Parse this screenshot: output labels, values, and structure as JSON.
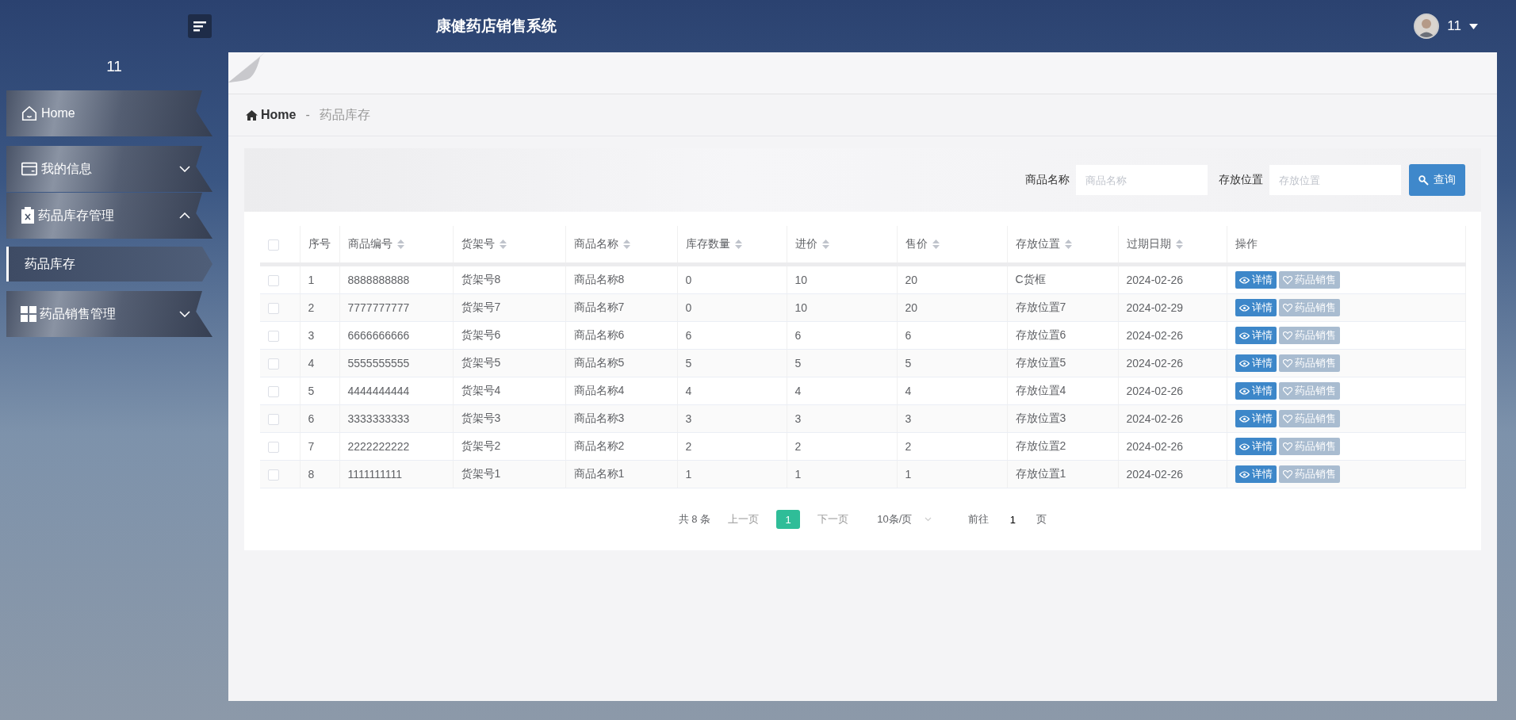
{
  "header": {
    "title": "康健药店销售系统",
    "user_name": "11"
  },
  "sidebar": {
    "user_name": "11",
    "items": [
      {
        "kind": "link",
        "label": "Home"
      },
      {
        "kind": "group",
        "label": "我的信息",
        "expanded": false
      },
      {
        "kind": "group",
        "label": "药品库存管理",
        "expanded": true,
        "children": [
          {
            "label": "药品库存",
            "selected": true
          }
        ]
      },
      {
        "kind": "group",
        "label": "药品销售管理",
        "expanded": false
      }
    ]
  },
  "breadcrumb": {
    "home": "Home",
    "separator": "-",
    "current": "药品库存"
  },
  "search": {
    "fields": [
      {
        "label": "商品名称",
        "placeholder": "商品名称"
      },
      {
        "label": "存放位置",
        "placeholder": "存放位置"
      }
    ],
    "button": "查询"
  },
  "table": {
    "select_all": {
      "checked": false
    },
    "columns": [
      {
        "label": "序号",
        "sortable": false
      },
      {
        "label": "商品编号",
        "sortable": true
      },
      {
        "label": "货架号",
        "sortable": true
      },
      {
        "label": "商品名称",
        "sortable": true
      },
      {
        "label": "库存数量",
        "sortable": true
      },
      {
        "label": "进价",
        "sortable": true
      },
      {
        "label": "售价",
        "sortable": true
      },
      {
        "label": "存放位置",
        "sortable": true
      },
      {
        "label": "过期日期",
        "sortable": true
      },
      {
        "label": "操作",
        "sortable": false
      }
    ],
    "rows": [
      {
        "checked": false,
        "cells": [
          "1",
          "8888888888",
          "货架号8",
          "商品名称8",
          "0",
          "10",
          "20",
          "C货框",
          "2024-02-26"
        ],
        "actions": [
          {
            "kind": "view",
            "label": "详情"
          },
          {
            "kind": "sell",
            "label": "药品销售"
          }
        ]
      },
      {
        "checked": false,
        "cells": [
          "2",
          "7777777777",
          "货架号7",
          "商品名称7",
          "0",
          "10",
          "20",
          "存放位置7",
          "2024-02-29"
        ],
        "actions": [
          {
            "kind": "view",
            "label": "详情"
          },
          {
            "kind": "sell",
            "label": "药品销售"
          }
        ]
      },
      {
        "checked": false,
        "cells": [
          "3",
          "6666666666",
          "货架号6",
          "商品名称6",
          "6",
          "6",
          "6",
          "存放位置6",
          "2024-02-26"
        ],
        "actions": [
          {
            "kind": "view",
            "label": "详情"
          },
          {
            "kind": "sell",
            "label": "药品销售"
          }
        ]
      },
      {
        "checked": false,
        "cells": [
          "4",
          "5555555555",
          "货架号5",
          "商品名称5",
          "5",
          "5",
          "5",
          "存放位置5",
          "2024-02-26"
        ],
        "actions": [
          {
            "kind": "view",
            "label": "详情"
          },
          {
            "kind": "sell",
            "label": "药品销售"
          }
        ]
      },
      {
        "checked": false,
        "cells": [
          "5",
          "4444444444",
          "货架号4",
          "商品名称4",
          "4",
          "4",
          "4",
          "存放位置4",
          "2024-02-26"
        ],
        "actions": [
          {
            "kind": "view",
            "label": "详情"
          },
          {
            "kind": "sell",
            "label": "药品销售"
          }
        ]
      },
      {
        "checked": false,
        "cells": [
          "6",
          "3333333333",
          "货架号3",
          "商品名称3",
          "3",
          "3",
          "3",
          "存放位置3",
          "2024-02-26"
        ],
        "actions": [
          {
            "kind": "view",
            "label": "详情"
          },
          {
            "kind": "sell",
            "label": "药品销售"
          }
        ]
      },
      {
        "checked": false,
        "cells": [
          "7",
          "2222222222",
          "货架号2",
          "商品名称2",
          "2",
          "2",
          "2",
          "存放位置2",
          "2024-02-26"
        ],
        "actions": [
          {
            "kind": "view",
            "label": "详情"
          },
          {
            "kind": "sell",
            "label": "药品销售"
          }
        ]
      },
      {
        "checked": false,
        "cells": [
          "8",
          "1111111111",
          "货架号1",
          "商品名称1",
          "1",
          "1",
          "1",
          "存放位置1",
          "2024-02-26"
        ],
        "actions": [
          {
            "kind": "view",
            "label": "详情"
          },
          {
            "kind": "sell",
            "label": "药品销售"
          }
        ]
      }
    ]
  },
  "pagination": {
    "total": "共 8 条",
    "prev": "上一页",
    "pages": [
      {
        "label": "1",
        "selected": true
      }
    ],
    "next": "下一页",
    "page_size": "10条/页",
    "goto_label": "前往",
    "goto_value": "1",
    "goto_unit": "页"
  }
}
